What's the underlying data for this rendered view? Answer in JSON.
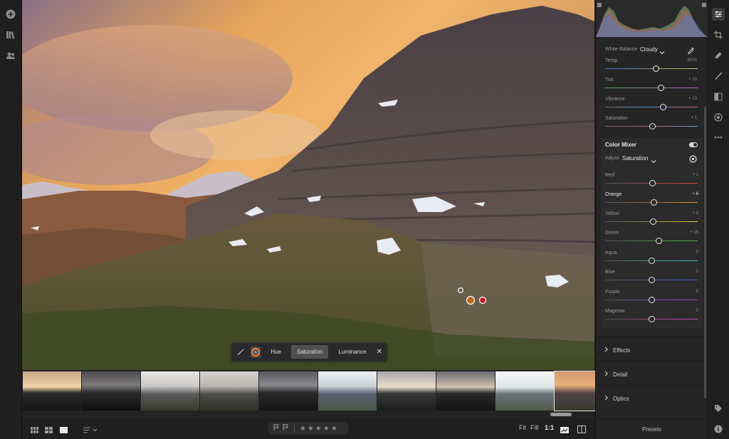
{
  "photo_toolbar": {
    "tabs": [
      {
        "label": "Hue"
      },
      {
        "label": "Saturation"
      },
      {
        "label": "Luminance"
      }
    ],
    "close_label": "✕"
  },
  "white_balance": {
    "label": "White Balance",
    "preset": "Cloudy"
  },
  "basic_sliders": [
    {
      "label": "Temp",
      "value": "6500",
      "fraction": 0.55
    },
    {
      "label": "Tint",
      "value": "+ 10",
      "fraction": 0.6
    },
    {
      "label": "Vibrance",
      "value": "+ 13",
      "fraction": 0.63
    },
    {
      "label": "Saturation",
      "value": "+ 1",
      "fraction": 0.51
    }
  ],
  "color_mixer": {
    "title": "Color Mixer",
    "adjust_label": "Adjust",
    "adjust_value": "Saturation",
    "sliders": [
      {
        "label": "Red",
        "value": "+ 1",
        "fraction": 0.51
      },
      {
        "label": "Orange",
        "value": "+ 6",
        "fraction": 0.53
      },
      {
        "label": "Yellow",
        "value": "+ 4",
        "fraction": 0.52
      },
      {
        "label": "Green",
        "value": "+ 15",
        "fraction": 0.58
      },
      {
        "label": "Aqua",
        "value": "0",
        "fraction": 0.5
      },
      {
        "label": "Blue",
        "value": "0",
        "fraction": 0.5
      },
      {
        "label": "Purple",
        "value": "0",
        "fraction": 0.5
      },
      {
        "label": "Magenta",
        "value": "0",
        "fraction": 0.5
      }
    ]
  },
  "sections": [
    {
      "label": "Effects"
    },
    {
      "label": "Detail"
    },
    {
      "label": "Optics"
    }
  ],
  "presets_label": "Presets",
  "bottom_bar": {
    "fit": "Fit",
    "fill": "Fill",
    "one_to_one": "1:1",
    "stars": "★★★★★"
  },
  "colors": {
    "accent": "#e0e0e0",
    "panel_bg": "#252525",
    "mixer_bg": "#2b2b2b"
  }
}
